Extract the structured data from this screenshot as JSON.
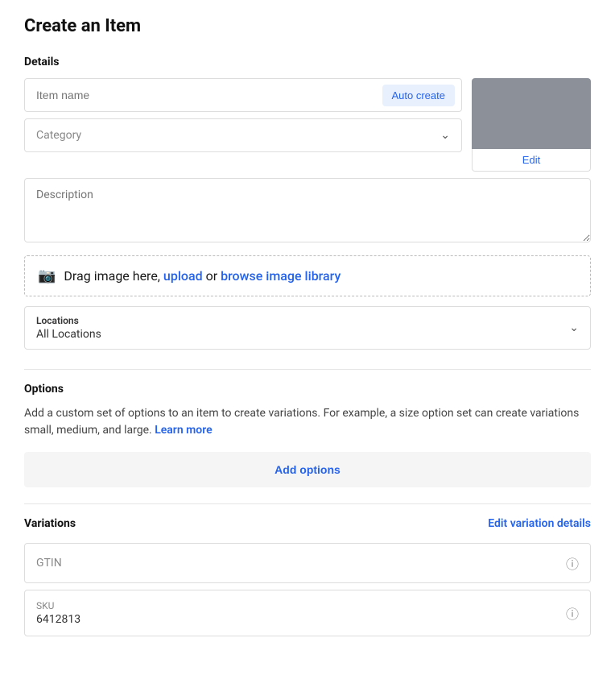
{
  "page": {
    "title": "Create an Item"
  },
  "details": {
    "section_label": "Details",
    "item_name_placeholder": "Item name",
    "auto_create_label": "Auto create",
    "category_placeholder": "Category",
    "description_placeholder": "Description",
    "image_upload_text": "Drag image here, ",
    "image_upload_link1": "upload",
    "image_upload_or": " or ",
    "image_upload_link2": "browse image library",
    "image_edit_label": "Edit",
    "locations_title": "Locations",
    "locations_value": "All Locations"
  },
  "options": {
    "section_label": "Options",
    "description": "Add a custom set of options to an item to create variations. For example, a size option set can create variations small, medium, and large. ",
    "learn_more_label": "Learn more",
    "add_options_label": "Add options"
  },
  "variations": {
    "section_label": "Variations",
    "edit_label": "Edit variation details",
    "gtin_label": "GTIN",
    "gtin_placeholder": "GTIN",
    "sku_label": "SKU",
    "sku_value": "6412813"
  }
}
